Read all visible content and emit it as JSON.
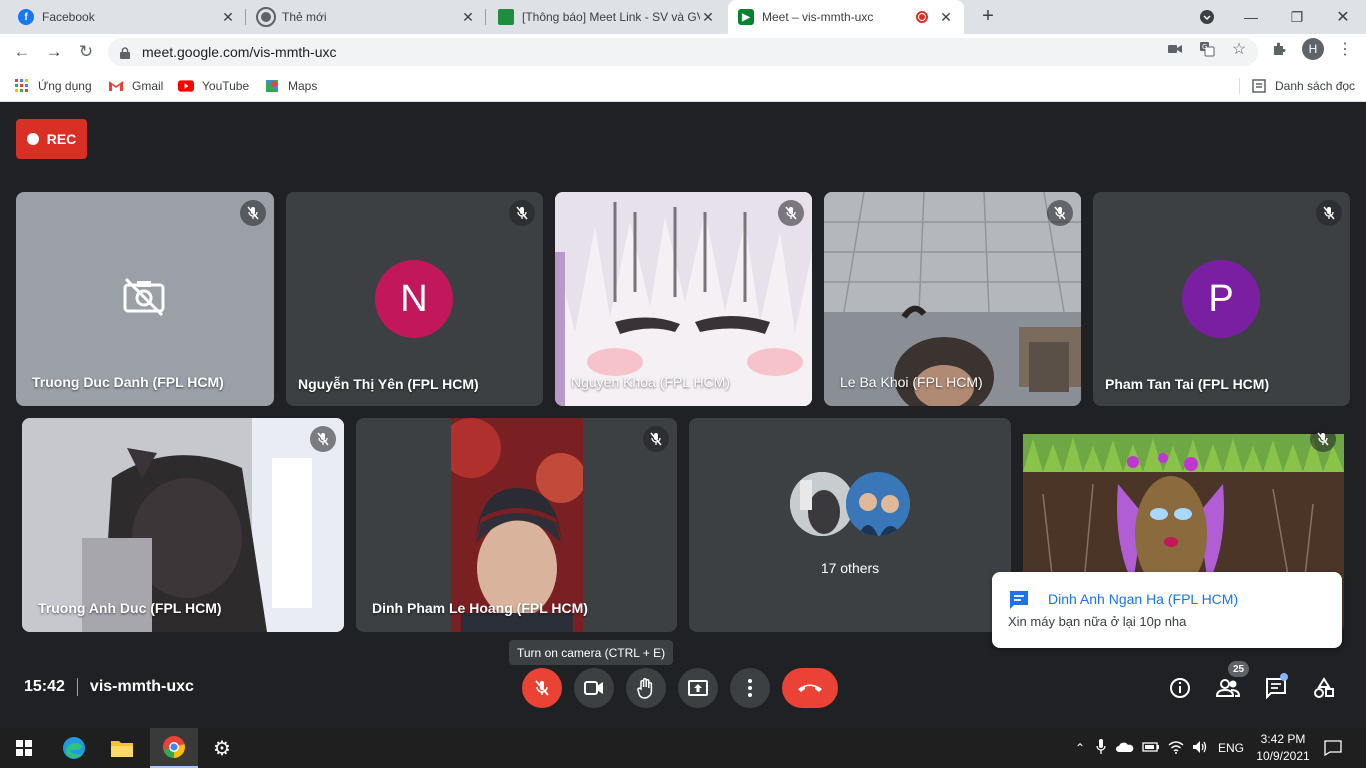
{
  "browser": {
    "tabs": [
      {
        "title": "Facebook",
        "favicon": "facebook-icon",
        "color": "#1877f2"
      },
      {
        "title": "Thẻ mới",
        "favicon": "chrome-icon",
        "color": "#5f6368"
      },
      {
        "title": "[Thông báo] Meet Link - SV và GV",
        "favicon": "classroom-icon",
        "color": "#1e8e3e"
      },
      {
        "title": "Meet – vis-mmth-uxc",
        "favicon": "meet-icon",
        "color": "#00832d"
      }
    ],
    "url": "meet.google.com/vis-mmth-uxc",
    "profile_initial": "H",
    "bookmarks": [
      "Ứng dụng",
      "Gmail",
      "YouTube",
      "Maps"
    ],
    "reading_list": "Danh sách đọc"
  },
  "meet": {
    "rec_label": "REC",
    "tiles": [
      {
        "name": "Truong Duc Danh (FPL HCM)"
      },
      {
        "name": "Nguyễn Thị Yên (FPL HCM)",
        "initial": "N",
        "color": "#c2185b"
      },
      {
        "name": "Nguyen Khoa (FPL HCM)"
      },
      {
        "name": "Le Ba Khoi (FPL HCM)"
      },
      {
        "name": "Pham Tan Tai (FPL HCM)",
        "initial": "P",
        "color": "#7b1fa2"
      },
      {
        "name": "Truong Anh Duc (FPL HCM)"
      },
      {
        "name": "Dinh Pham Le Hoang (FPL HCM)"
      },
      {
        "others": "17 others"
      }
    ],
    "notification": {
      "from": "Dinh Anh Ngan Ha (FPL HCM)",
      "message": "Xin máy bạn nữa ở lại 10p nha"
    },
    "tooltip": "Turn on camera (CTRL + E)",
    "time": "15:42",
    "meeting_code": "vis-mmth-uxc",
    "participant_count": "25"
  },
  "taskbar": {
    "language": "ENG",
    "time": "3:42 PM",
    "date": "10/9/2021"
  }
}
